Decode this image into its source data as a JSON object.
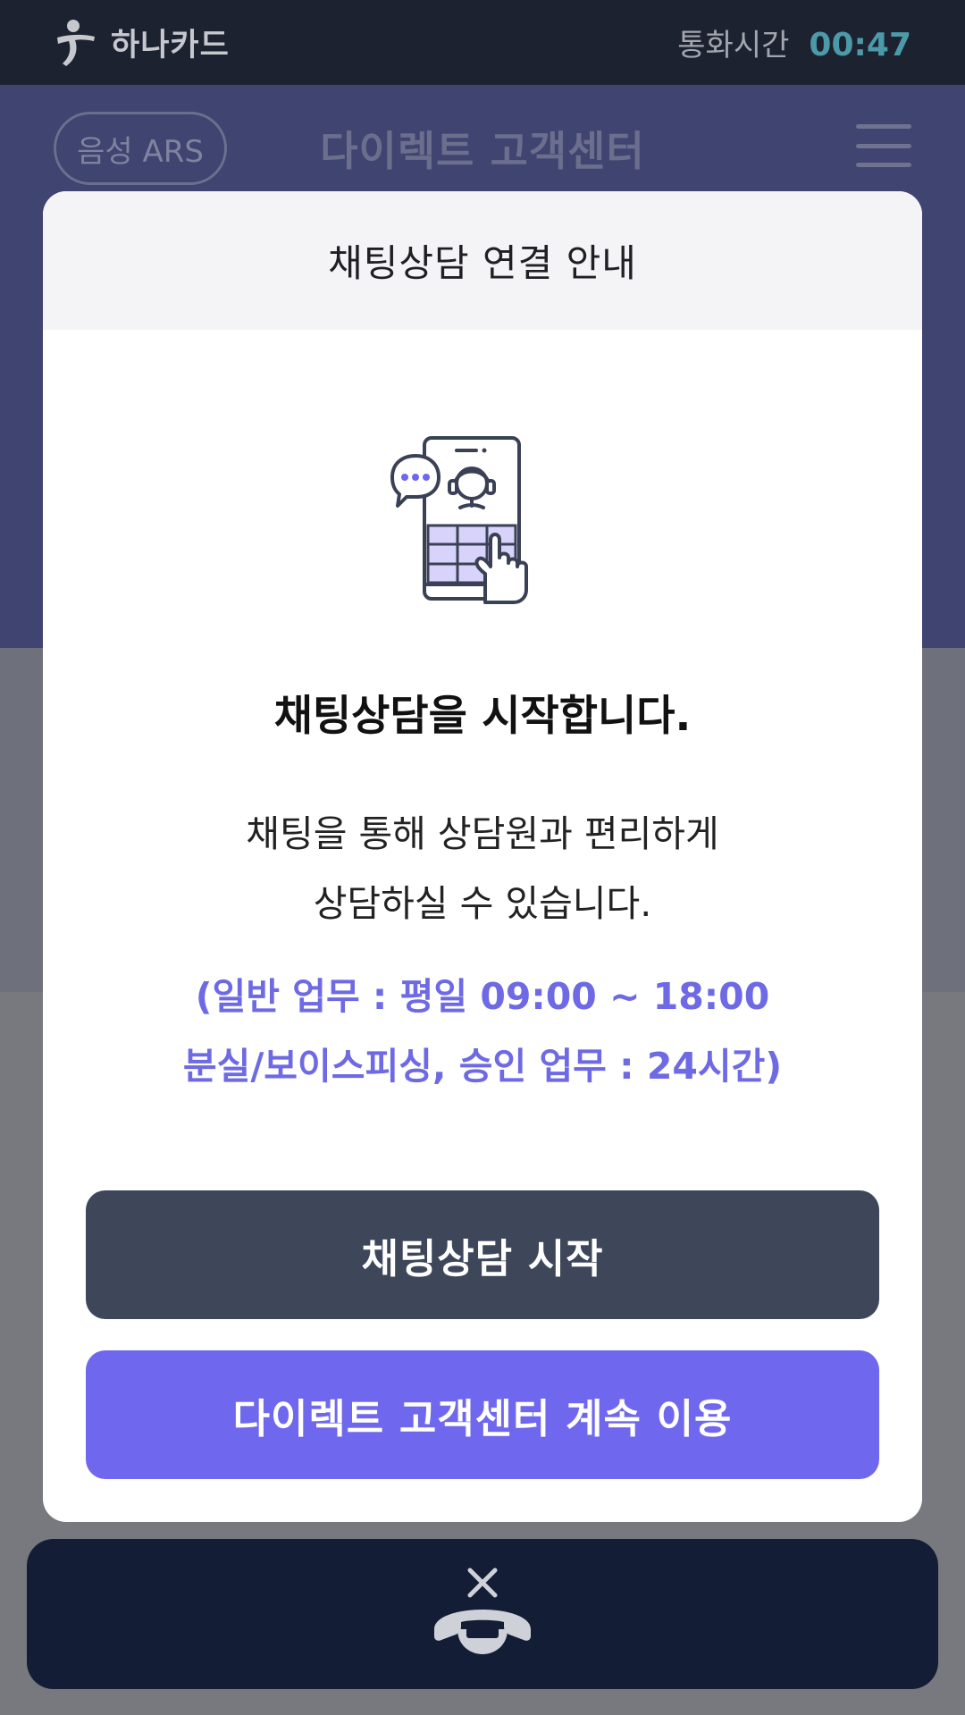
{
  "status_bar": {
    "brand_name": "하나카드",
    "call_time_label": "통화시간",
    "call_time_value": "00:47"
  },
  "header": {
    "ars_button_label": "음성 ARS",
    "title": "다이렉트 고객센터"
  },
  "modal": {
    "title": "채팅상담 연결 안내",
    "headline": "채팅상담을 시작합니다.",
    "description_lines": [
      "채팅을 통해 상담원과 편리하게",
      "상담하실 수 있습니다."
    ],
    "hours_lines": [
      "(일반 업무 : 평일 09:00 ~ 18:00",
      "분실/보이스피싱, 승인 업무 : 24시간)"
    ],
    "primary_button": "채팅상담 시작",
    "secondary_button": "다이렉트 고객센터 계속 이용"
  },
  "icons": {
    "logo": "hana-logo-icon",
    "menu": "menu-icon",
    "illustration": "chat-consultation-phone-icon",
    "hangup": "hangup-call-icon"
  },
  "colors": {
    "accent": "#6f68ee",
    "primary_button": "#3e475a",
    "call_time": "#4c9aa8",
    "hero": "#3f4470",
    "hangup_bar": "#141d36"
  }
}
